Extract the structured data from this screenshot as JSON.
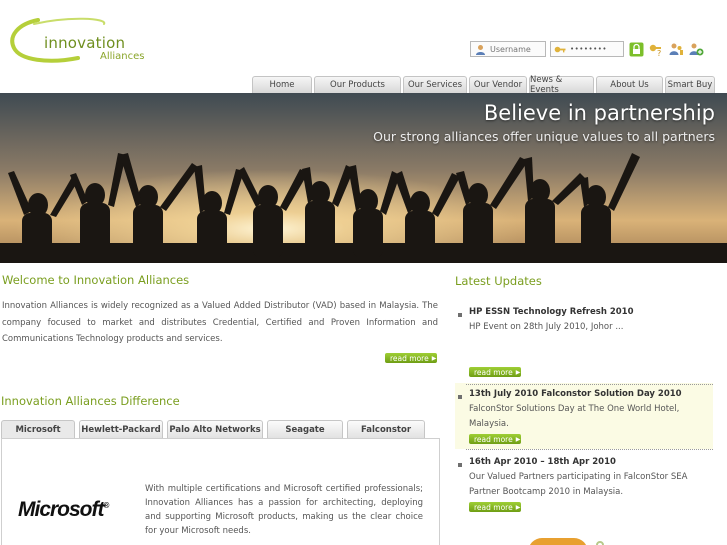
{
  "logo": {
    "main": "innovation",
    "sub": "Alliances"
  },
  "login": {
    "username_placeholder": "Username",
    "password_value": "••••••••"
  },
  "nav": {
    "tabs": [
      {
        "label": "Home"
      },
      {
        "label": "Our Products"
      },
      {
        "label": "Our Services"
      },
      {
        "label": "Our Vendor"
      },
      {
        "label": "News & Events"
      },
      {
        "label": "About Us"
      },
      {
        "label": "Smart Buy"
      }
    ]
  },
  "hero": {
    "title": "Believe in partnership",
    "subtitle": "Our strong alliances offer unique values to all partners"
  },
  "welcome": {
    "title": "Welcome to Innovation Alliances",
    "text": "Innovation Alliances is widely recognized as a Valued Added Distributor (VAD) based in Malaysia. The company focused to market and distributes Credential, Certified and Proven Information and Communications Technology products and services.",
    "read_more": "read more"
  },
  "difference": {
    "title": "Innovation Alliances Difference",
    "tabs": [
      {
        "label": "Microsoft"
      },
      {
        "label": "Hewlett-Packard"
      },
      {
        "label": "Palo Alto Networks"
      },
      {
        "label": "Seagate"
      },
      {
        "label": "Falconstor"
      }
    ],
    "active_tab": "Microsoft",
    "logo_text": "Microsoft",
    "logo_mark": "®",
    "text": "With multiple certifications and Microsoft certified professionals; Innovation Alliances has a passion for architecting, deploying and supporting Microsoft products, making us the clear choice for your Microsoft needs."
  },
  "updates": {
    "title": "Latest Updates",
    "items": [
      {
        "title": "HP ESSN Technology Refresh 2010",
        "desc": "HP Event on 28th July 2010, Johor ...",
        "read_more": "read more"
      },
      {
        "title": "13th July 2010 Falconstor Solution Day 2010",
        "desc": "FalconStor Solutions Day at The One World Hotel, Malaysia.",
        "read_more": "read more"
      },
      {
        "title": "16th Apr 2010 – 18th Apr 2010",
        "desc": "Our Valued Partners participating in FalconStor SEA Partner Bootcamp 2010 in Malaysia.",
        "read_more": "read more"
      }
    ]
  },
  "colors": {
    "brand_green": "#7a9e1f",
    "button_green": "#8bbf2a",
    "highlight": "#fbfbe4"
  },
  "icons": [
    "user-icon",
    "key-icon",
    "lock-icon",
    "help-key-icon",
    "users-icon",
    "add-user-icon",
    "arrow-right-icon"
  ]
}
